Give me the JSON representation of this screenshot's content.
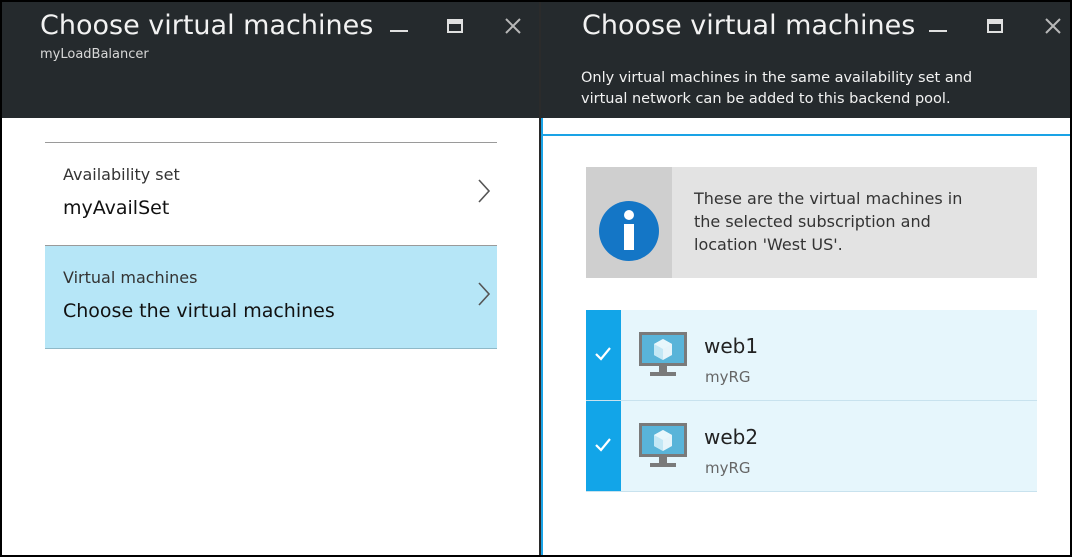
{
  "left_blade": {
    "title": "Choose virtual machines",
    "subtitle": "myLoadBalancer",
    "items": [
      {
        "label": "Availability set",
        "value": "myAvailSet",
        "selected": false
      },
      {
        "label": "Virtual machines",
        "value": "Choose the virtual machines",
        "selected": true
      }
    ]
  },
  "right_blade": {
    "title": "Choose virtual machines",
    "description_line1": "Only virtual machines in the same availability set and",
    "description_line2": "virtual network can be added to this backend pool.",
    "info": {
      "line1": "These are the virtual machines in",
      "line2": "the selected subscription and",
      "line3": "location 'West US'."
    },
    "vms": [
      {
        "name": "web1",
        "resource_group": "myRG",
        "checked": true
      },
      {
        "name": "web2",
        "resource_group": "myRG",
        "checked": true
      }
    ]
  },
  "colors": {
    "header_bg": "#252a2d",
    "accent": "#12a5e8",
    "selected_bg": "#b6e6f7",
    "vm_row_bg": "#e6f6fc"
  }
}
